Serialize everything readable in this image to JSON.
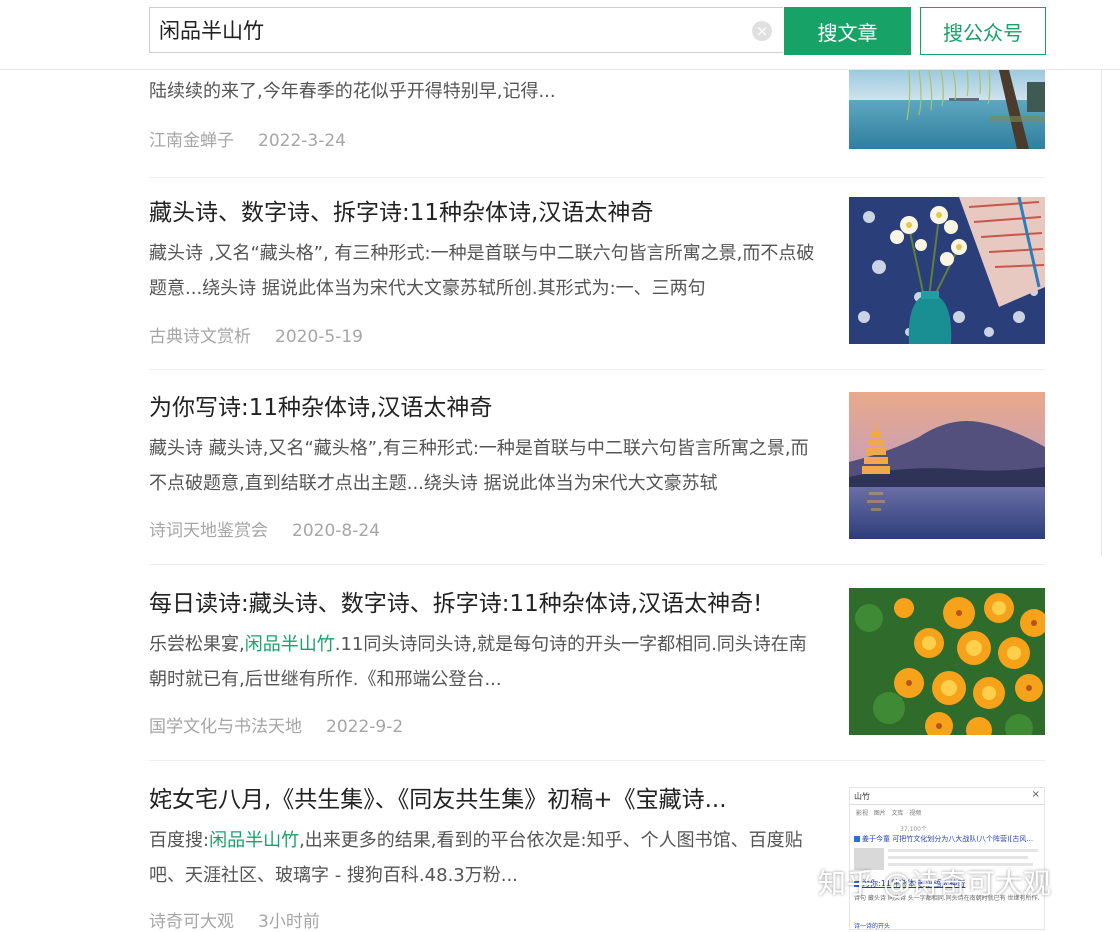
{
  "search": {
    "query": "闲品半山竹",
    "article_button": "搜文章",
    "account_button": "搜公众号"
  },
  "results": [
    {
      "title": "",
      "snippet": "陆续续的来了,今年春季的花似乎开得特别早,记得...",
      "source": "江南金蝉子",
      "date": "2022-3-24",
      "thumb": "willow-lake"
    },
    {
      "title": "藏头诗、数字诗、拆字诗:11种杂体诗,汉语太神奇",
      "snippet": "藏头诗 ,又名“藏头格”, 有三种形式:一种是首联与中二联六句皆言所寓之景,而不点破题意...绕头诗 据说此体当为宋代大文豪苏轼所创.其形式为:一、三两句",
      "source": "古典诗文赏析",
      "date": "2020-5-19",
      "thumb": "vase-flowers"
    },
    {
      "title": "为你写诗:11种杂体诗,汉语太神奇",
      "snippet": "藏头诗 藏头诗,又名“藏头格”,有三种形式:一种是首联与中二联六句皆言所寓之景,而不点破题意,直到结联才点出主题...绕头诗 据说此体当为宋代大文豪苏轼",
      "source": "诗词天地鉴赏会",
      "date": "2020-8-24",
      "thumb": "pagoda-dusk"
    },
    {
      "title": "每日读诗:藏头诗、数字诗、拆字诗:11种杂体诗,汉语太神奇!",
      "snippet_before": "乐尝松果宴,",
      "snippet_highlight": "闲品半山竹",
      "snippet_after": ".11同头诗同头诗,就是每句诗的开头一字都相同.同头诗在南朝时就已有,后世继有所作.《和邢端公登台...",
      "source": "国学文化与书法天地",
      "date": "2022-9-2",
      "thumb": "orange-flowers"
    },
    {
      "title": "姹女宅八月,《共生集》、《同友共生集》初稿+《宝藏诗...",
      "snippet_before": "百度搜:",
      "snippet_highlight": "闲品半山竹",
      "snippet_after": ",出来更多的结果,看到的平台依次是:知乎、个人图书馆、百度贴吧、天涯社区、玻璃字 - 搜狗百科.48.3万粉...",
      "source": "诗奇可大观",
      "date": "3小时前",
      "thumb": "screenshot",
      "thumb_text": {
        "query": "山竹",
        "tabs": [
          "影视",
          "图片",
          "文库",
          "视频"
        ],
        "count": "37,100个",
        "line1": "姜于今童 可把竹文化划分为八大战队(八个阵营)[古风...",
        "line2": "为你:11种杂体诗,汉语太神奇",
        "snip": "诗句 藏头诗 同头诗 头一字都相同.同头诗在南朝时就已有 世继有所作.",
        "link": "诗一诗的开头"
      }
    }
  ],
  "watermark": "知乎 @诗奇可大观",
  "colors": {
    "accent": "#17a367",
    "meta": "#a6a6a6",
    "snippet": "#555555"
  }
}
